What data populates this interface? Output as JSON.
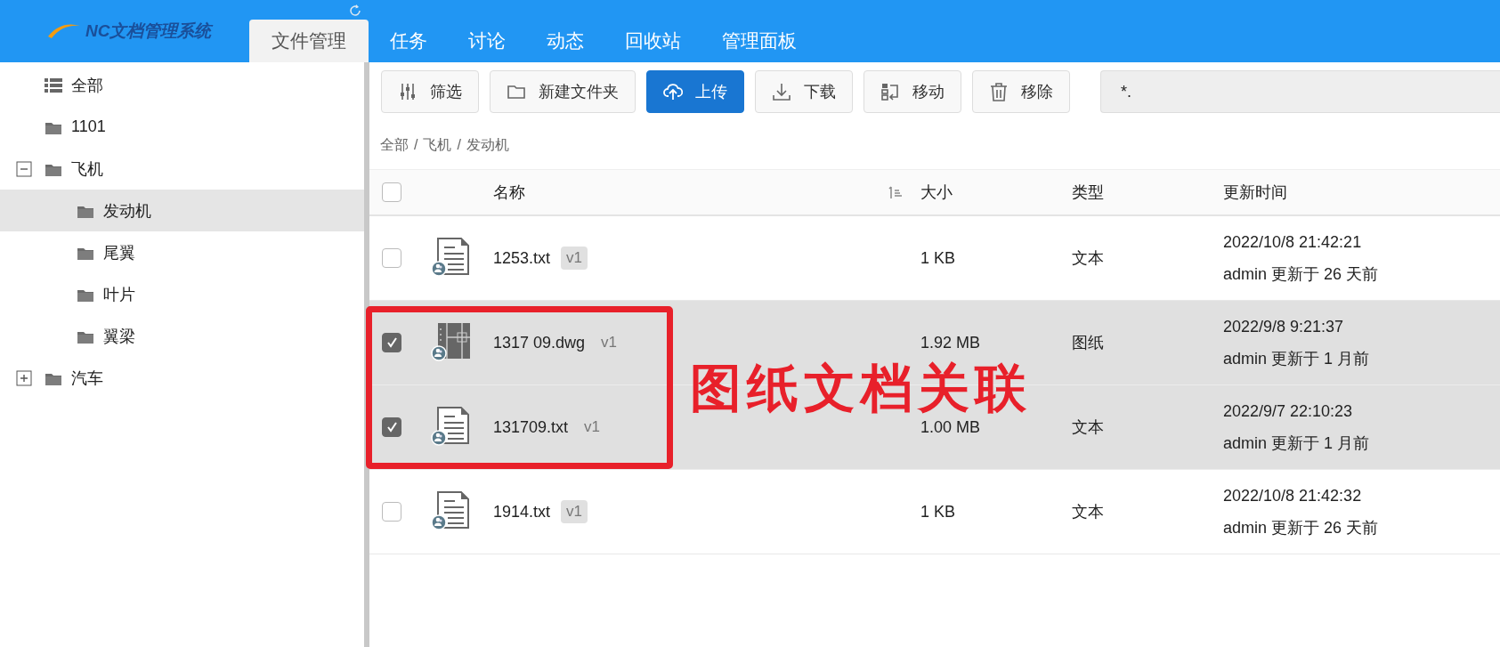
{
  "header": {
    "logo_text": "NC文档管理系统"
  },
  "tabs": [
    {
      "label": "文件管理",
      "selected": true
    },
    {
      "label": "任务",
      "selected": false
    },
    {
      "label": "讨论",
      "selected": false
    },
    {
      "label": "动态",
      "selected": false
    },
    {
      "label": "回收站",
      "selected": false
    },
    {
      "label": "管理面板",
      "selected": false
    }
  ],
  "sidebar": {
    "items": [
      {
        "label": "全部",
        "kind": "all",
        "selected": false
      },
      {
        "label": "1101",
        "kind": "folder",
        "selected": false
      },
      {
        "label": "飞机",
        "kind": "folder",
        "selected": false,
        "expanded": true,
        "children": [
          {
            "label": "发动机",
            "kind": "folder",
            "selected": true
          },
          {
            "label": "尾翼",
            "kind": "folder",
            "selected": false
          },
          {
            "label": "叶片",
            "kind": "folder",
            "selected": false
          },
          {
            "label": "翼梁",
            "kind": "folder",
            "selected": false
          }
        ]
      },
      {
        "label": "汽车",
        "kind": "folder",
        "selected": false,
        "expanded": false
      }
    ]
  },
  "toolbar": {
    "buttons": [
      {
        "label": "筛选",
        "kind": "filter",
        "primary": false
      },
      {
        "label": "新建文件夹",
        "kind": "new-folder",
        "primary": false
      },
      {
        "label": "上传",
        "kind": "upload",
        "primary": true
      },
      {
        "label": "下载",
        "kind": "download",
        "primary": false
      },
      {
        "label": "移动",
        "kind": "move",
        "primary": false
      },
      {
        "label": "移除",
        "kind": "remove",
        "primary": false
      }
    ],
    "search": {
      "value": "*."
    }
  },
  "breadcrumb": {
    "items": [
      "全部",
      "飞机",
      "发动机"
    ],
    "separator": "/"
  },
  "table": {
    "select_all": {
      "checked": false
    },
    "columns": [
      {
        "label": "名称",
        "sorted": true
      },
      {
        "label": "大小",
        "sorted": false
      },
      {
        "label": "类型",
        "sorted": false
      },
      {
        "label": "更新时间",
        "sorted": false
      }
    ],
    "rows": [
      {
        "selected": false,
        "kind": "text",
        "name": "1253.txt",
        "version": "v1",
        "size": "1 KB",
        "type": "文本",
        "updated": "2022/10/8 21:42:21",
        "updated_by": "admin 更新于 26 天前"
      },
      {
        "selected": true,
        "kind": "drawing",
        "name": "1317 09.dwg",
        "version": "v1",
        "size": "1.92 MB",
        "type": "图纸",
        "updated": "2022/9/8 9:21:37",
        "updated_by": "admin 更新于 1 月前"
      },
      {
        "selected": true,
        "kind": "text",
        "name": "131709.txt",
        "version": "v1",
        "size": "1.00 MB",
        "type": "文本",
        "updated": "2022/9/7 22:10:23",
        "updated_by": "admin 更新于 1 月前"
      },
      {
        "selected": false,
        "kind": "text",
        "name": "1914.txt",
        "version": "v1",
        "size": "1 KB",
        "type": "文本",
        "updated": "2022/10/8 21:42:32",
        "updated_by": "admin 更新于 26 天前"
      }
    ]
  },
  "annotation": {
    "text": "图纸文档关联"
  }
}
